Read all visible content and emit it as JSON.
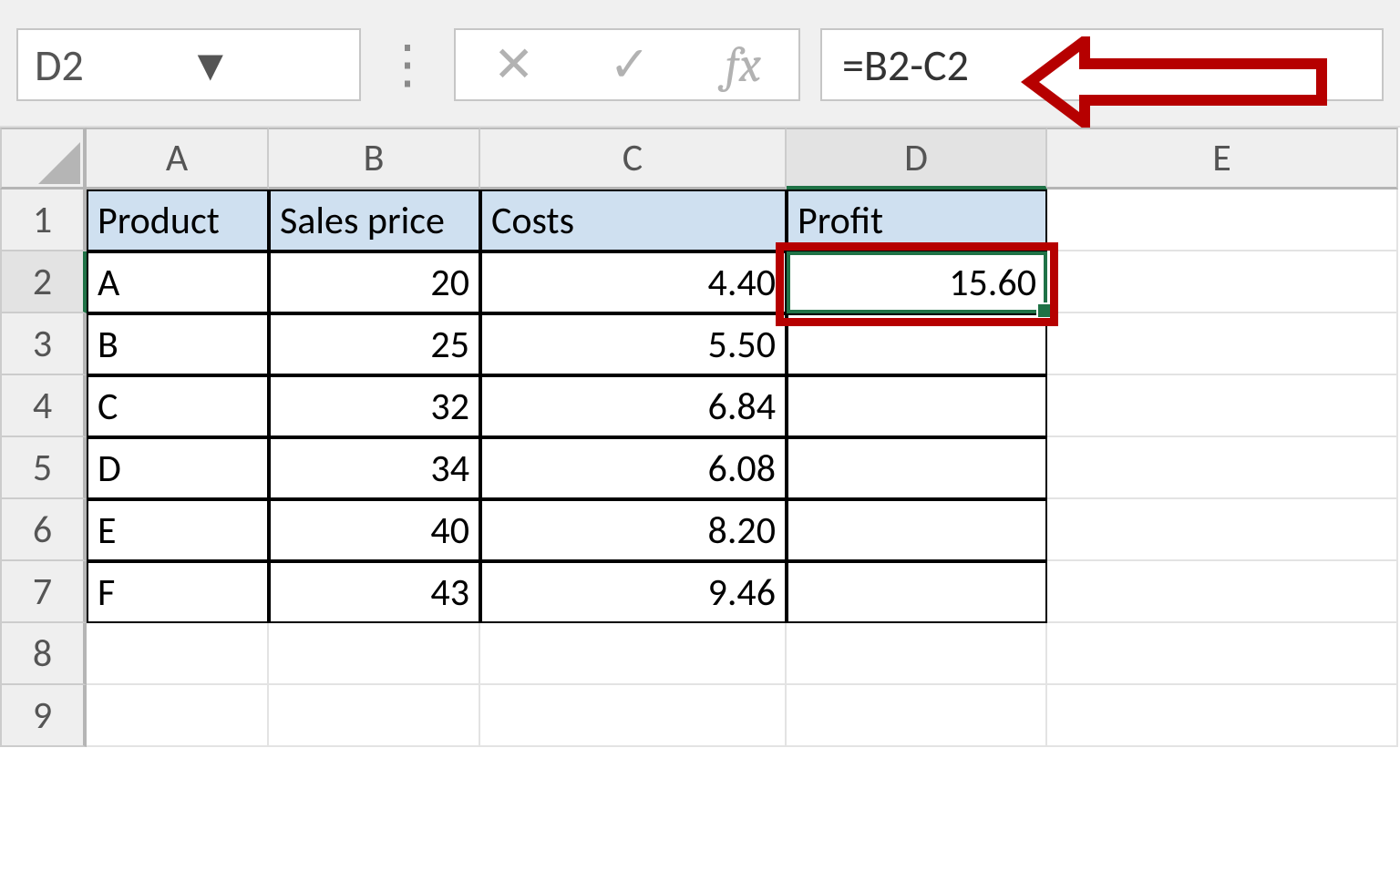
{
  "name_box": "D2",
  "formula": "=B2-C2",
  "columns": [
    "A",
    "B",
    "C",
    "D",
    "E"
  ],
  "rows": [
    "1",
    "2",
    "3",
    "4",
    "5",
    "6",
    "7",
    "8",
    "9"
  ],
  "headers": {
    "A": "Product",
    "B": "Sales price",
    "C": "Costs",
    "D": "Profit"
  },
  "data": [
    {
      "A": "A",
      "B": "20",
      "C": "4.40",
      "D": "15.60"
    },
    {
      "A": "B",
      "B": "25",
      "C": "5.50",
      "D": ""
    },
    {
      "A": "C",
      "B": "32",
      "C": "6.84",
      "D": ""
    },
    {
      "A": "D",
      "B": "34",
      "C": "6.08",
      "D": ""
    },
    {
      "A": "E",
      "B": "40",
      "C": "8.20",
      "D": ""
    },
    {
      "A": "F",
      "B": "43",
      "C": "9.46",
      "D": ""
    }
  ],
  "chart_data": {
    "type": "table",
    "title": "",
    "columns": [
      "Product",
      "Sales price",
      "Costs",
      "Profit"
    ],
    "rows": [
      [
        "A",
        20,
        4.4,
        15.6
      ],
      [
        "B",
        25,
        5.5,
        null
      ],
      [
        "C",
        32,
        6.84,
        null
      ],
      [
        "D",
        34,
        6.08,
        null
      ],
      [
        "E",
        40,
        8.2,
        null
      ],
      [
        "F",
        43,
        9.46,
        null
      ]
    ]
  }
}
